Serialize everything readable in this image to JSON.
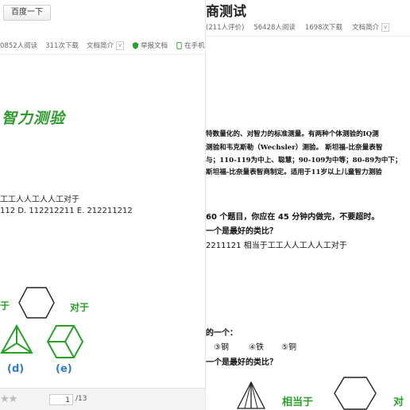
{
  "left": {
    "toolbar": {
      "baidu_button": "百度一下"
    },
    "stats": {
      "reads": "0852人阅读",
      "downloads": "311次下载",
      "intro": "文档简介",
      "report": "举报文档",
      "mobile": "在手机打开"
    },
    "doc": {
      "title": "智力测验",
      "q_line1": "工工人人工人人工对于",
      "q_line2": "112    D. 112212211    E. 212211212",
      "fig_left_text": "于",
      "fig_right_text": "对于",
      "opt_d": "(d)",
      "opt_e": "(e)"
    },
    "footer": {
      "stars": "★★",
      "page_current": "1",
      "page_total": "/13"
    }
  },
  "right": {
    "title": "商测试",
    "stats": {
      "rating": "(211人评价)",
      "reads": "56428人阅读",
      "downloads": "1698次下载",
      "intro": "文档简介"
    },
    "scan_lines": [
      "特数量化的、对智力的标准测量。有两种个体测验的IQ测",
      "测验和韦克斯勒（Wechsler）测验。 斯坦福-比奈量表智",
      "与；110-119为中上、聪慧；90-109为中等；80-89为中下；",
      "斯坦福-比奈量表智商制定。适用于11岁以上儿童智力测验"
    ],
    "intro_line": "60 个题目，你应在 45 分钟内做完，不要超时。",
    "q_best1": "一个是最好的类比？",
    "q_analogy": "2211121 相当于工工人人工人人工对于",
    "q_which": "的一个：",
    "options": [
      "③钢",
      "④铁",
      "⑤铜"
    ],
    "q_best2": "一个是最好的类比？",
    "fig_label": "相当于",
    "fig_label2": "对于"
  }
}
